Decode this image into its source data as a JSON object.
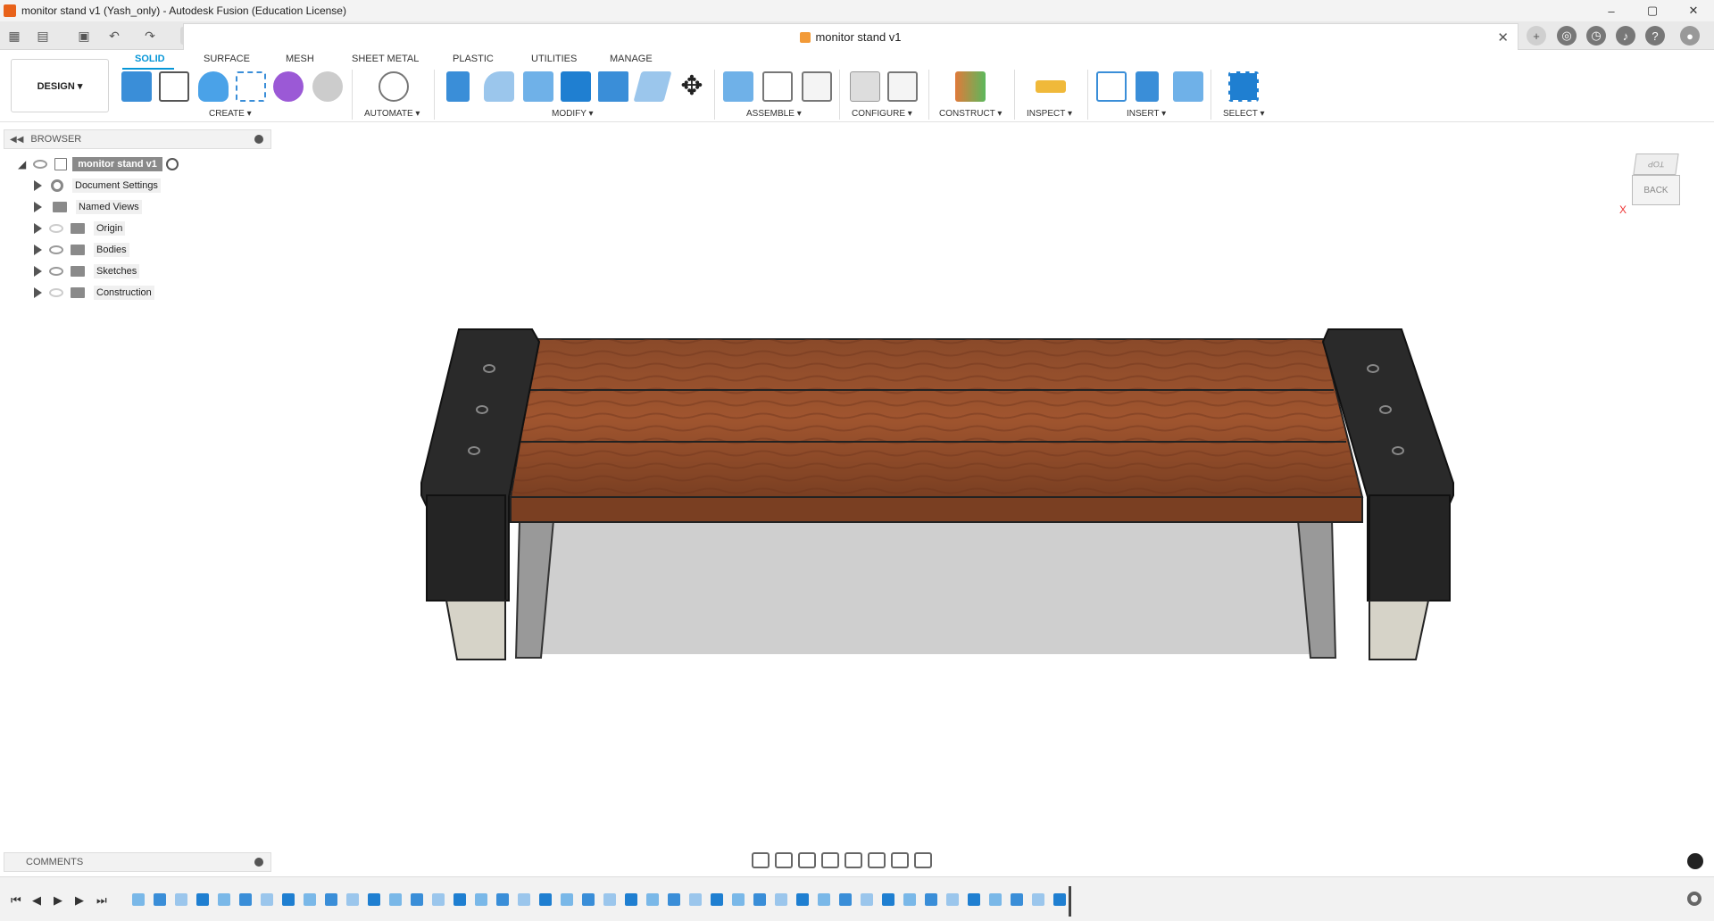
{
  "window": {
    "title": "monitor stand v1 (Yash_only) - Autodesk Fusion (Education License)",
    "controls": [
      "–",
      "▢",
      "✕"
    ]
  },
  "doc_tab": {
    "title": "monitor stand v1",
    "close": "✕"
  },
  "workspace": {
    "label": "DESIGN ▾"
  },
  "tabs": [
    "SOLID",
    "SURFACE",
    "MESH",
    "SHEET METAL",
    "PLASTIC",
    "UTILITIES",
    "MANAGE"
  ],
  "groups": [
    "CREATE ▾",
    "AUTOMATE ▾",
    "MODIFY ▾",
    "ASSEMBLE ▾",
    "CONFIGURE ▾",
    "CONSTRUCT ▾",
    "INSPECT ▾",
    "INSERT ▾",
    "SELECT ▾"
  ],
  "browser": {
    "title": "BROWSER",
    "root": "monitor stand v1",
    "items": [
      "Document Settings",
      "Named Views",
      "Origin",
      "Bodies",
      "Sketches",
      "Construction"
    ]
  },
  "viewcube": {
    "top": "TOP",
    "back": "BACK",
    "axis_x": "X"
  },
  "comments": {
    "title": "COMMENTS"
  }
}
